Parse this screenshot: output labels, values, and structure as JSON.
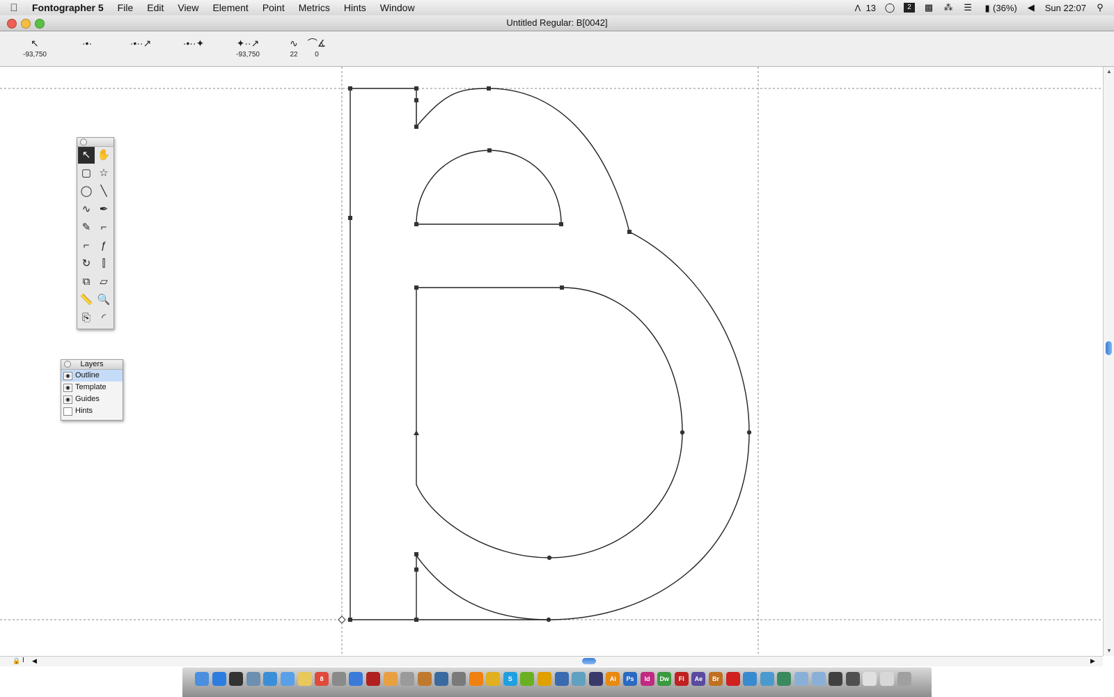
{
  "menubar": {
    "app_name": "Fontographer 5",
    "menus": [
      "File",
      "Edit",
      "View",
      "Element",
      "Point",
      "Metrics",
      "Hints",
      "Window"
    ],
    "status": {
      "adobe_count": "13",
      "battery": "(36%)",
      "clock": "Sun 22:07"
    }
  },
  "window": {
    "title": "Untitled Regular: B[0042]"
  },
  "infobar": {
    "items": [
      {
        "icon": "arrow-pointer-icon",
        "glyph": "↖",
        "value": "-93,750"
      },
      {
        "icon": "point-icon",
        "glyph": "·•·",
        "value": ""
      },
      {
        "icon": "point-offset-icon",
        "glyph": "·•··↗",
        "value": ""
      },
      {
        "icon": "point-move-icon",
        "glyph": "·•··✦",
        "value": ""
      },
      {
        "icon": "distance-icon",
        "glyph": "✦··↗",
        "value": "-93,750"
      },
      {
        "icon": "curve-icon",
        "glyph": "∿",
        "value": "22"
      },
      {
        "icon": "angle-icon",
        "glyph": "⌒∡",
        "value": "0"
      }
    ]
  },
  "tools": [
    {
      "name": "pointer-tool",
      "glyph": "↖",
      "selected": true
    },
    {
      "name": "hand-tool",
      "glyph": "✋"
    },
    {
      "name": "rectangle-tool",
      "glyph": "▢"
    },
    {
      "name": "star-tool",
      "glyph": "☆"
    },
    {
      "name": "ellipse-tool",
      "glyph": "◯"
    },
    {
      "name": "line-tool",
      "glyph": "╲"
    },
    {
      "name": "freehand-tool",
      "glyph": "∿"
    },
    {
      "name": "pen-tool",
      "glyph": "✒"
    },
    {
      "name": "brush-tool",
      "glyph": "✎"
    },
    {
      "name": "curve-point-tool",
      "glyph": "⌐"
    },
    {
      "name": "corner-point-tool",
      "glyph": "⌐"
    },
    {
      "name": "tangent-point-tool",
      "glyph": "ƒ"
    },
    {
      "name": "rotate-tool",
      "glyph": "↻"
    },
    {
      "name": "reflect-tool",
      "glyph": "⫿"
    },
    {
      "name": "scale-tool",
      "glyph": "⧉"
    },
    {
      "name": "skew-tool",
      "glyph": "▱"
    },
    {
      "name": "measure-tool",
      "glyph": "📏"
    },
    {
      "name": "zoom-tool",
      "glyph": "🔍"
    },
    {
      "name": "knife-tool",
      "glyph": "⎘"
    },
    {
      "name": "corner-rounding-tool",
      "glyph": "◜"
    }
  ],
  "layers": {
    "title": "Layers",
    "items": [
      {
        "label": "Outline",
        "visible": true,
        "active": true
      },
      {
        "label": "Template",
        "visible": true,
        "active": false
      },
      {
        "label": "Guides",
        "visible": true,
        "active": false
      },
      {
        "label": "Hints",
        "visible": false,
        "active": false
      }
    ]
  },
  "dock": {
    "apps": [
      {
        "name": "finder",
        "label": "",
        "color": "#4a8fe0"
      },
      {
        "name": "app-store",
        "label": "",
        "color": "#2d7de0"
      },
      {
        "name": "dashboard",
        "label": "",
        "color": "#333333"
      },
      {
        "name": "preview",
        "label": "",
        "color": "#6d8fb0"
      },
      {
        "name": "safari",
        "label": "",
        "color": "#3a8fd8"
      },
      {
        "name": "messages",
        "label": "",
        "color": "#5aa0e8"
      },
      {
        "name": "notes",
        "label": "",
        "color": "#e8c85a"
      },
      {
        "name": "calendar",
        "label": "8",
        "color": "#e04a3a"
      },
      {
        "name": "photos",
        "label": "",
        "color": "#8a8a8a"
      },
      {
        "name": "itunes",
        "label": "",
        "color": "#3a7ad8"
      },
      {
        "name": "photobooth",
        "label": "",
        "color": "#b02020"
      },
      {
        "name": "iphoto",
        "label": "",
        "color": "#e8a040"
      },
      {
        "name": "automator",
        "label": "",
        "color": "#9a9a9a"
      },
      {
        "name": "garageband",
        "label": "",
        "color": "#c07a30"
      },
      {
        "name": "time-machine",
        "label": "",
        "color": "#3a6aa0"
      },
      {
        "name": "system-preferences",
        "label": "",
        "color": "#7a7a7a"
      },
      {
        "name": "vlc",
        "label": "",
        "color": "#f08010"
      },
      {
        "name": "chrome",
        "label": "",
        "color": "#e0b020"
      },
      {
        "name": "skype",
        "label": "S",
        "color": "#20a0e0"
      },
      {
        "name": "spotify",
        "label": "",
        "color": "#6ab020"
      },
      {
        "name": "fontlab",
        "label": "",
        "color": "#e0a000"
      },
      {
        "name": "network",
        "label": "",
        "color": "#3a6ab0"
      },
      {
        "name": "app-extra",
        "label": "",
        "color": "#60a0c0"
      },
      {
        "name": "fontographer",
        "label": "",
        "color": "#3a3a6a"
      },
      {
        "name": "illustrator",
        "label": "Ai",
        "color": "#e88a10"
      },
      {
        "name": "photoshop",
        "label": "Ps",
        "color": "#2a6ac0"
      },
      {
        "name": "indesign",
        "label": "Id",
        "color": "#c02a80"
      },
      {
        "name": "dreamweaver",
        "label": "Dw",
        "color": "#3a9a40"
      },
      {
        "name": "flash",
        "label": "Fl",
        "color": "#c02020"
      },
      {
        "name": "after-effects",
        "label": "Ae",
        "color": "#5a4aa0"
      },
      {
        "name": "bridge",
        "label": "Br",
        "color": "#c07020"
      },
      {
        "name": "acrobat",
        "label": "",
        "color": "#d02020"
      },
      {
        "name": "app-a",
        "label": "",
        "color": "#3a8ad0"
      },
      {
        "name": "app-b",
        "label": "",
        "color": "#4a9ad0"
      },
      {
        "name": "app-c",
        "label": "",
        "color": "#3a8a60"
      },
      {
        "name": "folder-1",
        "label": "",
        "color": "#8ab0d8"
      },
      {
        "name": "folder-2",
        "label": "",
        "color": "#8ab0d8"
      },
      {
        "name": "window-1",
        "label": "",
        "color": "#404040"
      },
      {
        "name": "window-2",
        "label": "",
        "color": "#505050"
      },
      {
        "name": "window-3",
        "label": "",
        "color": "#e0e0e0"
      },
      {
        "name": "window-4",
        "label": "",
        "color": "#d8d8d8"
      },
      {
        "name": "trash",
        "label": "",
        "color": "#a0a0a0"
      }
    ]
  }
}
